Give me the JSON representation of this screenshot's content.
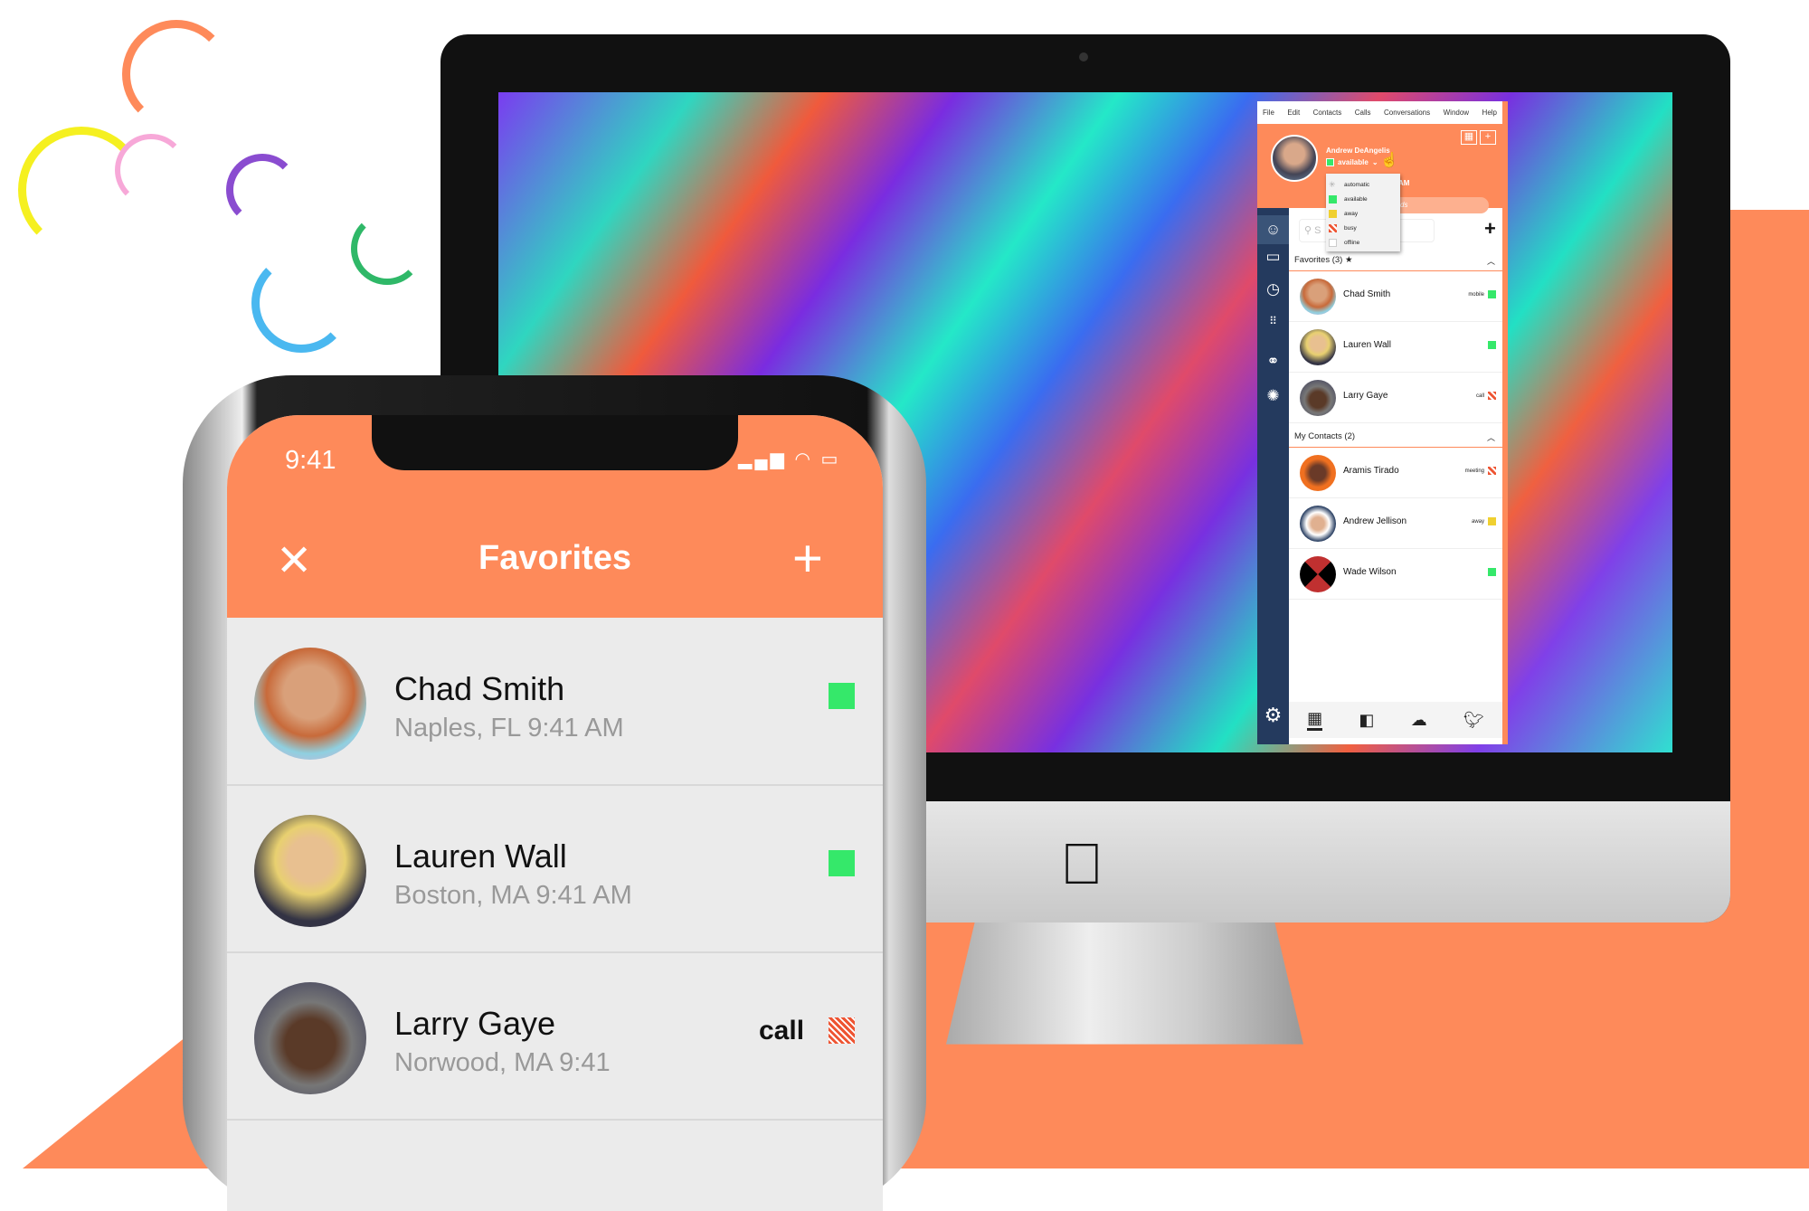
{
  "colors": {
    "accent": "#fe8a5a",
    "sidebar": "#243a5e",
    "available": "#35e86a",
    "away": "#f0d030",
    "busy": "#e53333"
  },
  "desktop_app": {
    "menu": [
      "File",
      "Edit",
      "Contacts",
      "Calls",
      "Conversations",
      "Window",
      "Help"
    ],
    "user": {
      "name": "Andrew DeAngelis",
      "status": "available",
      "time_partial": "AM",
      "search_hint_partial": "ds"
    },
    "status_menu": [
      {
        "label": "automatic"
      },
      {
        "label": "available"
      },
      {
        "label": "away"
      },
      {
        "label": "busy"
      },
      {
        "label": "offline"
      }
    ],
    "search_placeholder": "S",
    "favorites_header": "Favorites (3) ★",
    "favorites": [
      {
        "name": "Chad Smith",
        "status_text": "mobile",
        "status": "available"
      },
      {
        "name": "Lauren Wall",
        "status_text": "",
        "status": "available"
      },
      {
        "name": "Larry Gaye",
        "status_text": "call",
        "status": "busy"
      }
    ],
    "contacts_header": "My Contacts (2)",
    "contacts": [
      {
        "name": "Aramis Tirado",
        "status_text": "meeting",
        "status": "busy"
      },
      {
        "name": "Andrew Jellison",
        "status_text": "away",
        "status": "away"
      },
      {
        "name": "Wade Wilson",
        "status_text": "",
        "status": "available"
      }
    ],
    "sidebar_icons": [
      "user-icon",
      "chat-icon",
      "clock-icon",
      "dialpad-icon",
      "link-icon",
      "network-icon",
      "gear-icon"
    ],
    "bottom_icons": [
      "calendar-icon",
      "outlook-icon",
      "cloud-icon",
      "twitter-icon"
    ]
  },
  "phone": {
    "time": "9:41",
    "title": "Favorites",
    "rows": [
      {
        "name": "Chad Smith",
        "location": "Naples, FL  9:41 AM",
        "status_text": "",
        "status": "available"
      },
      {
        "name": "Lauren Wall",
        "location": "Boston, MA  9:41 AM",
        "status_text": "",
        "status": "available"
      },
      {
        "name": "Larry Gaye",
        "location": "Norwood, MA  9:41",
        "status_text": "call",
        "status": "busy"
      }
    ]
  }
}
